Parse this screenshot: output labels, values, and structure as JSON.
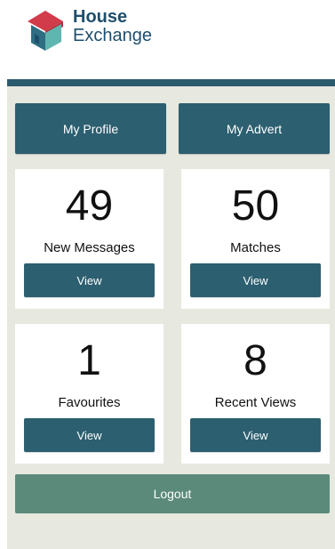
{
  "brand": {
    "line1": "House",
    "line2": "Exchange"
  },
  "nav": {
    "profile_label": "My Profile",
    "advert_label": "My Advert"
  },
  "cards": [
    {
      "count": "49",
      "label": "New Messages",
      "button": "View"
    },
    {
      "count": "50",
      "label": "Matches",
      "button": "View"
    },
    {
      "count": "1",
      "label": "Favourites",
      "button": "View"
    },
    {
      "count": "8",
      "label": "Recent Views",
      "button": "View"
    }
  ],
  "logout_label": "Logout",
  "colors": {
    "brand_text": "#1f4e6c",
    "button_dark": "#2c5f70",
    "logout": "#5b8a7a",
    "panel_bg": "#e7e8df",
    "logo_red": "#d23b4a",
    "logo_teal": "#2e6d82"
  },
  "icons": {
    "logo": "house-logo-icon"
  }
}
